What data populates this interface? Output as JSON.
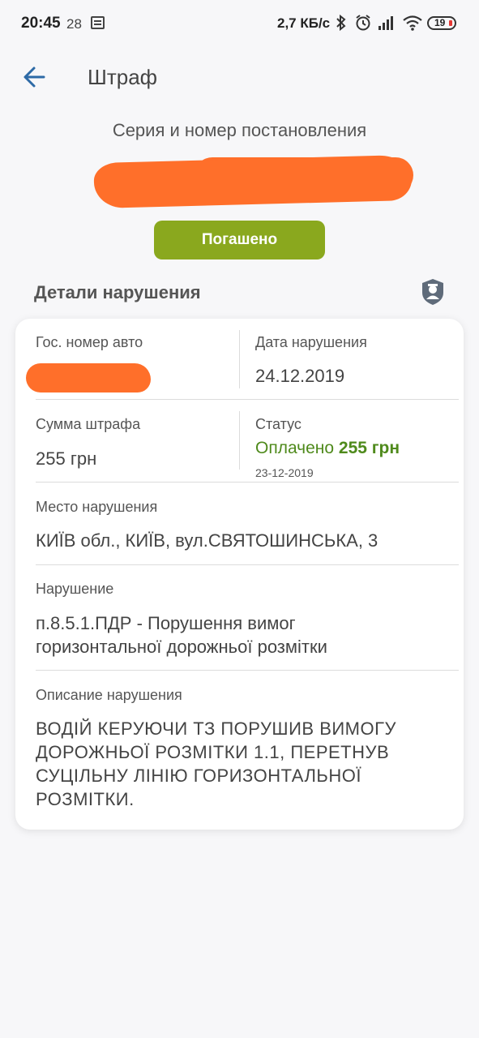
{
  "status_bar": {
    "time": "20:45",
    "date": "28",
    "net_speed": "2,7 КБ/с",
    "battery": "19"
  },
  "app_bar": {
    "title": "Штраф"
  },
  "fine": {
    "series_label": "Серия и номер постановления",
    "status_button": "Погашено"
  },
  "details": {
    "heading": "Детали нарушения",
    "plate_label": "Гос. номер авто",
    "date_label": "Дата нарушения",
    "date_value": "24.12.2019",
    "sum_label": "Сумма штрафа",
    "sum_value": "255 грн",
    "status_label": "Статус",
    "status_text": "Оплачено",
    "status_amount": "255 грн",
    "status_date": "23-12-2019",
    "place_label": "Место нарушения",
    "place_value": "КИЇВ обл., КИЇВ, вул.СВЯТОШИНСЬКА, 3",
    "violation_label": "Нарушение",
    "violation_value": "п.8.5.1.ПДР - Порушення вимог горизонтальної дорожньої розмітки",
    "description_label": "Описание нарушения",
    "description_value": "ВОДІЙ КЕРУЮЧИ ТЗ ПОРУШИВ ВИМОГУ ДОРОЖНЬОЇ РОЗМІТКИ 1.1, ПЕРЕТНУВ СУЦІЛЬНУ ЛІНІЮ ГОРИЗОНТАЛЬНОЇ РОЗМІТКИ."
  },
  "icons": [
    "calendar-icon",
    "bluetooth-icon",
    "alarm-icon",
    "signal-icon",
    "wifi-icon",
    "battery-icon",
    "back-arrow-icon",
    "police-badge-icon"
  ],
  "colors": {
    "accent_button": "#8aa81e",
    "paid_green": "#4f8a1c",
    "back_arrow": "#2d6aa6",
    "redaction": "#ff6f2a"
  }
}
